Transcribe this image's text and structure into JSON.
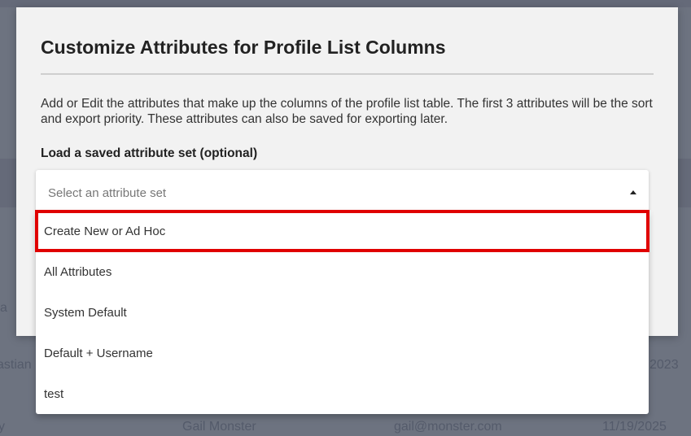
{
  "modal": {
    "title": "Customize Attributes for Profile List Columns",
    "description": "Add or Edit the attributes that make up the columns of the profile list table. The first 3 attributes will be the sort and export priority. These attributes can also be saved for exporting later.",
    "field_label": "Load a saved attribute set (optional)"
  },
  "select": {
    "placeholder": "Select an attribute set",
    "options": [
      "Create New or Ad Hoc",
      "All Attributes",
      "System Default",
      "Default + Username",
      "test"
    ],
    "highlighted_index": 0,
    "highlight_color": "#e00000"
  },
  "background": {
    "row1_left": "a",
    "row2_left": "astian",
    "row2_right": "2023",
    "row3_left": "y",
    "row3_name": "Gail Monster",
    "row3_email": "gail@monster.com",
    "row3_date": "11/19/2025"
  }
}
